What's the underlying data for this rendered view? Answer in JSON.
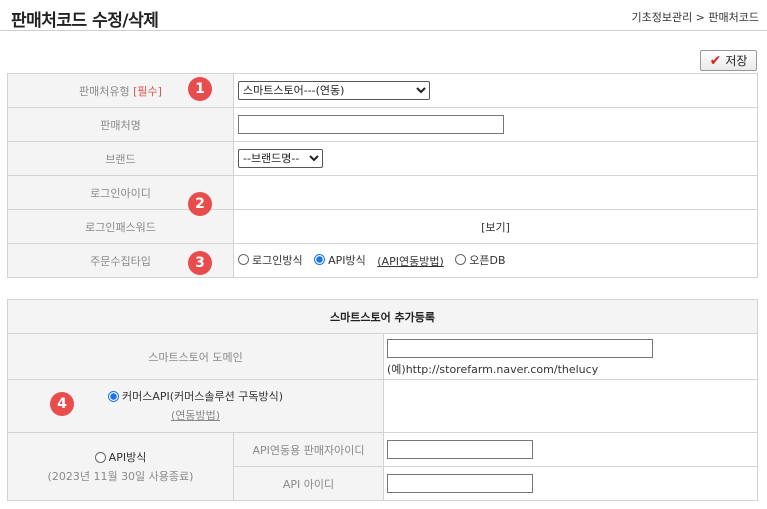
{
  "header": {
    "title": "판매처코드 수정/삭제",
    "breadcrumb": "기초정보관리 > 판매처코드"
  },
  "toolbar": {
    "save_label": "저장"
  },
  "form": {
    "type_label": "판매처유형",
    "required_tag": "[필수]",
    "type_value": "스마트스토어---(연동)",
    "name_label": "판매처명",
    "name_value": "",
    "brand_label": "브랜드",
    "brand_value": "--브랜드명--",
    "login_id_label": "로그인아이디",
    "login_pw_label": "로그인패스워드",
    "view_link": "[보기]",
    "collect_label": "주문수집타입",
    "collect_options": [
      "로그인방식",
      "API방식",
      "오픈DB"
    ],
    "collect_selected": "API방식",
    "api_guide_link": "(API연동방법)"
  },
  "smartstore": {
    "section_title": "스마트스토어 추가등록",
    "domain_label": "스마트스토어 도메인",
    "domain_value": "",
    "domain_example": "(예)http://storefarm.naver.com/thelucy",
    "commerce_api_label": "커머스API(커머스솔루션 구독방식)",
    "commerce_api_link": "(연동방법)",
    "api_method_label": "API방식",
    "api_method_note": "(2023년 11월 30일 사용종료)",
    "seller_id_label": "API연동용 판매자아이디",
    "api_id_label": "API 아이디"
  },
  "badges": [
    "1",
    "2",
    "3",
    "4"
  ]
}
